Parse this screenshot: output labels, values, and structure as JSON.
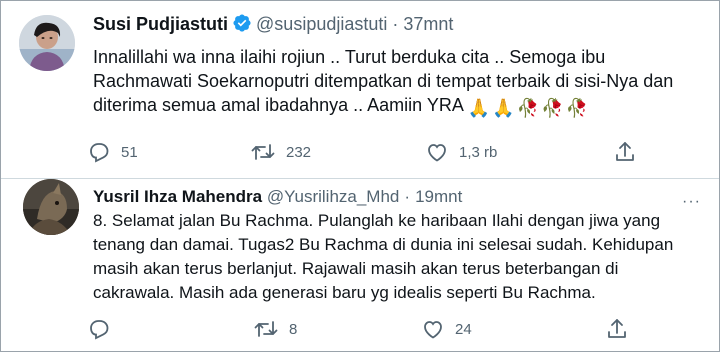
{
  "tweets": [
    {
      "name": "Susi Pudjiastuti",
      "handle": "@susipudjiastuti",
      "separator": "·",
      "time": "37mnt",
      "verified": true,
      "text": "Innalillahi wa inna ilaihi rojiun .. Turut berduka cita .. Semoga ibu\nRachmawati Soekarnoputri ditempatkan di tempat terbaik di sisi-Nya dan\nditerima semua amal ibadahnya .. Aamiin YRA",
      "emojis": [
        "🙏",
        "🙏",
        "🥀",
        "🥀",
        "🥀"
      ],
      "replies": "51",
      "retweets": "232",
      "likes": "1,3 rb"
    },
    {
      "name": "Yusril Ihza Mahendra",
      "handle": "@Yusrilihza_Mhd",
      "separator": "·",
      "time": "19mnt",
      "verified": false,
      "text": "8. Selamat jalan Bu Rachma. Pulanglah ke haribaan Ilahi dengan jiwa yang\ntenang dan damai. Tugas2 Bu Rachma di dunia ini selesai sudah. Kehidupan\nmasih akan terus berlanjut. Rajawali masih akan terus beterbangan di\ncakrawala. Masih ada generasi baru yg idealis seperti Bu Rachma.",
      "replies": "",
      "retweets": "8",
      "likes": "24",
      "more_label": "···"
    }
  ],
  "colors": {
    "verified_blue": "#1d9bf0",
    "text": "#0f1419",
    "muted": "#536471",
    "divider": "#cfd9de",
    "border": "#9aa3ab"
  }
}
